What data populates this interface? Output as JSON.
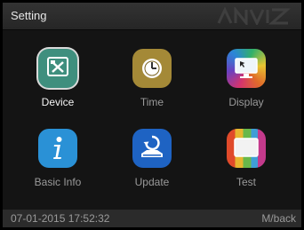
{
  "header": {
    "title": "Setting",
    "brand_logo": "ANVIZ"
  },
  "menu": {
    "items": [
      {
        "id": "device",
        "label": "Device",
        "icon": "tools-icon",
        "color": "#3f8f7e",
        "selected": true
      },
      {
        "id": "time",
        "label": "Time",
        "icon": "clock-icon",
        "color": "#a48937",
        "selected": false
      },
      {
        "id": "display",
        "label": "Display",
        "icon": "monitor-icon",
        "color": "#6b3fbf",
        "selected": false
      },
      {
        "id": "basic-info",
        "label": "Basic Info",
        "icon": "info-icon",
        "color": "#2a91d6",
        "selected": false
      },
      {
        "id": "update",
        "label": "Update",
        "icon": "update-icon",
        "color": "#1e63c3",
        "selected": false
      },
      {
        "id": "test",
        "label": "Test",
        "icon": "test-icon",
        "color": "#e04a2a",
        "selected": false
      }
    ]
  },
  "status": {
    "datetime": "07-01-2015 17:52:32",
    "hint": "M/back"
  }
}
